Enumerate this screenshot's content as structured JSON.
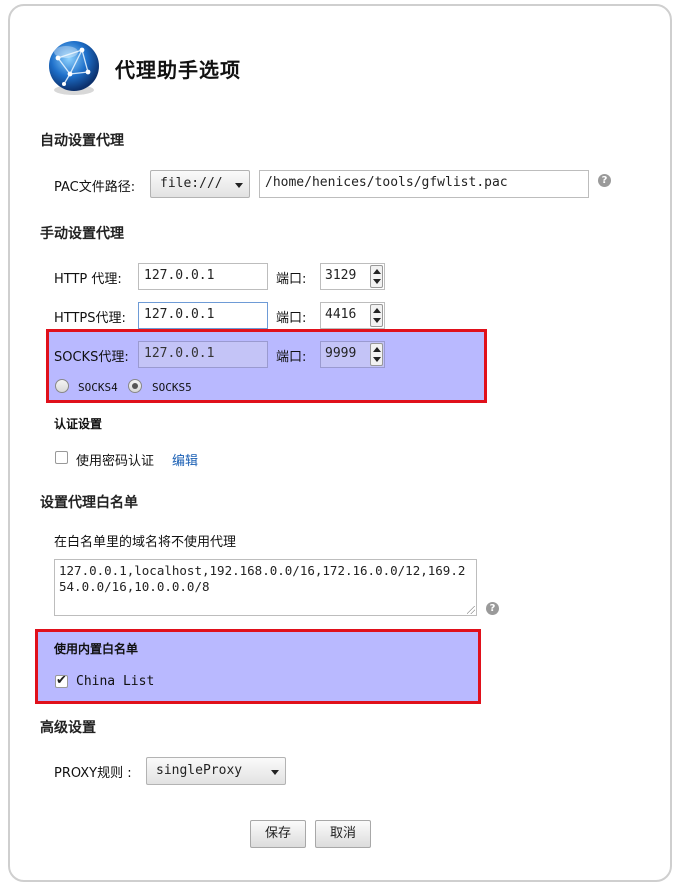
{
  "header": {
    "title": "代理助手选项",
    "logo_icon": "globe-network-icon"
  },
  "auto_proxy": {
    "section_title": "自动设置代理",
    "pac_label": "PAC文件路径:",
    "pac_scheme": "file:///",
    "pac_path": "/home/henices/tools/gfwlist.pac",
    "help_glyph": "?"
  },
  "manual_proxy": {
    "section_title": "手动设置代理",
    "port_label": "端口:",
    "http": {
      "label": "HTTP 代理:",
      "host": "127.0.0.1",
      "port": "3129"
    },
    "https": {
      "label": "HTTPS代理:",
      "host": "127.0.0.1",
      "port": "4416"
    },
    "socks": {
      "label": "SOCKS代理:",
      "host": "127.0.0.1",
      "port": "9999",
      "options": [
        "SOCKS4",
        "SOCKS5"
      ],
      "selected": "SOCKS5"
    },
    "auth": {
      "title": "认证设置",
      "checkbox_label": "使用密码认证",
      "checked": false,
      "edit_link": "编辑"
    }
  },
  "whitelist": {
    "section_title": "设置代理白名单",
    "description": "在白名单里的域名将不使用代理",
    "value": "127.0.0.1,localhost,192.168.0.0/16,172.16.0.0/12,169.254.0.0/16,10.0.0.0/8",
    "help_glyph": "?",
    "builtin_title": "使用内置白名单",
    "china_list_label": "China List",
    "china_list_checked": true
  },
  "advanced": {
    "section_title": "高级设置",
    "proxy_rule_label": "PROXY规则 :",
    "proxy_rule_value": "singleProxy"
  },
  "footer": {
    "save_label": "保存",
    "cancel_label": "取消"
  },
  "colors": {
    "highlight_fill": "#b9b9ff",
    "highlight_border": "#e0101b",
    "link": "#1a5fb4"
  }
}
